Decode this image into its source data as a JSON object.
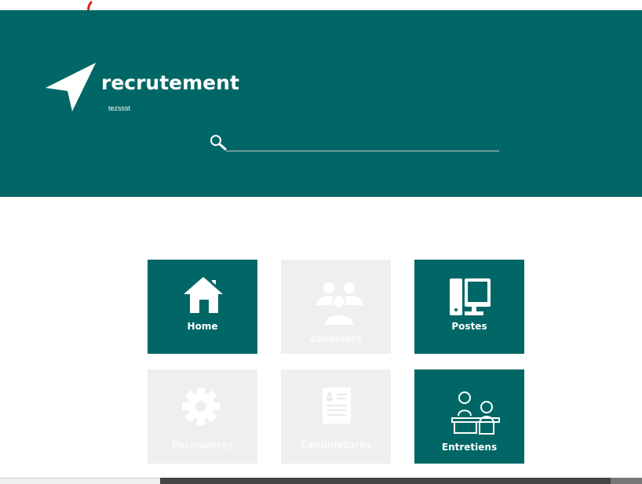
{
  "header": {
    "title": "recrutement",
    "subtitle": "tezssst",
    "search": {
      "value": "",
      "placeholder": ""
    }
  },
  "tiles": [
    {
      "label": "Home",
      "icon": "home-icon",
      "active": true
    },
    {
      "label": "candidats",
      "icon": "users-icon",
      "active": false
    },
    {
      "label": "Postes",
      "icon": "computer-icon",
      "active": true
    },
    {
      "label": "Paramètres",
      "icon": "gear-icon",
      "active": false
    },
    {
      "label": "Candidatures",
      "icon": "document-icon",
      "active": false
    },
    {
      "label": "Entretiens",
      "icon": "interview-icon",
      "active": true
    }
  ],
  "colors": {
    "brand": "#006766",
    "disabled": "#efefef"
  }
}
